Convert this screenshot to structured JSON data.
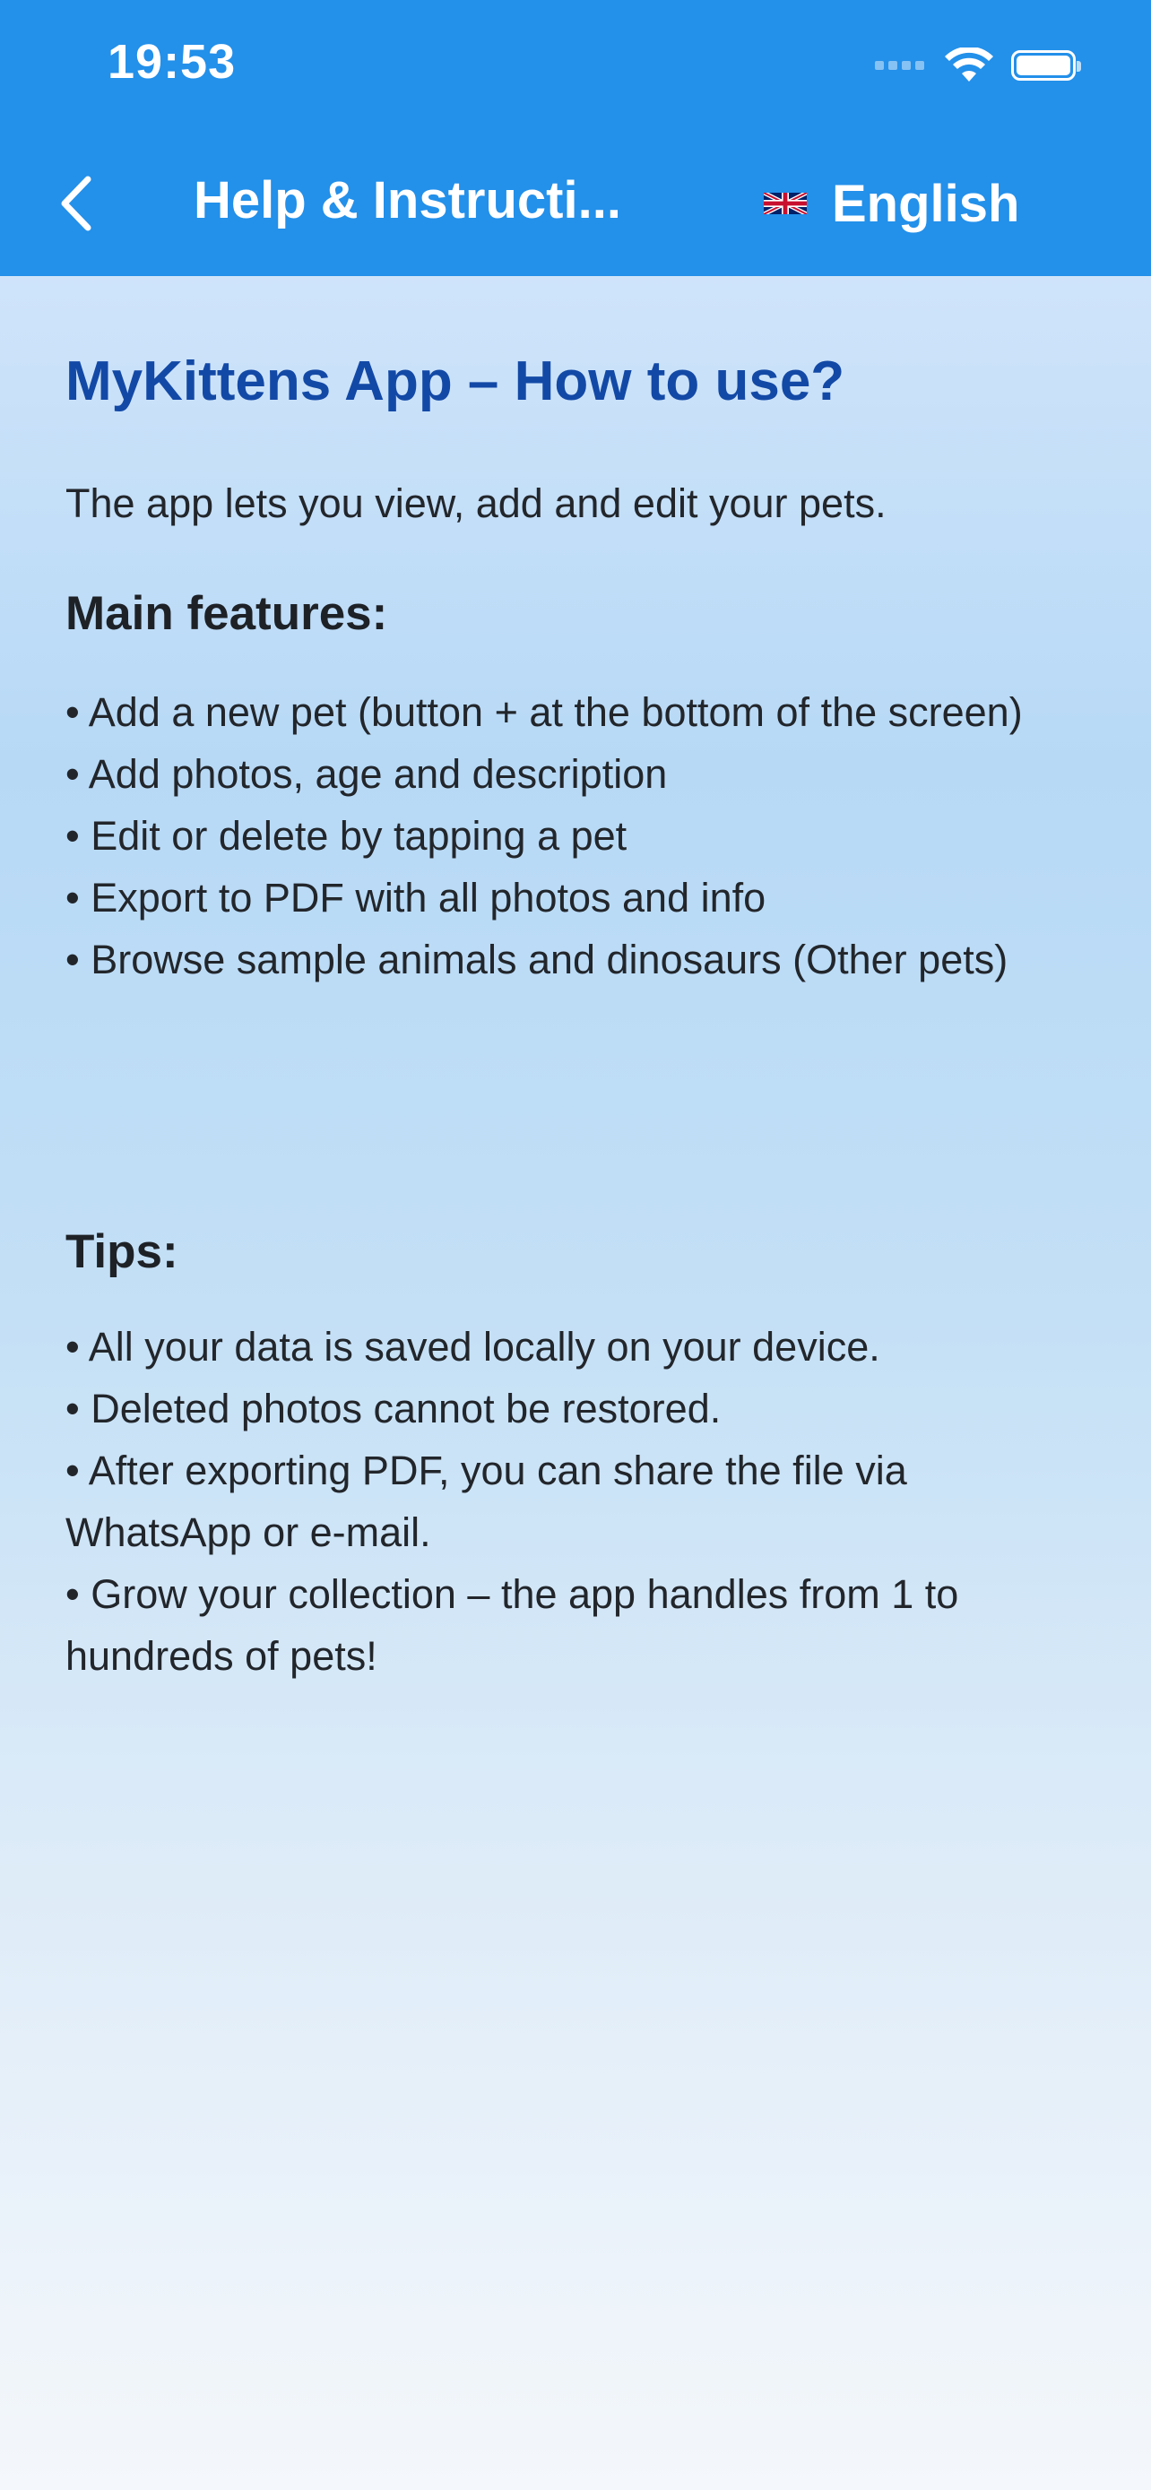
{
  "status_bar": {
    "time": "19:53"
  },
  "nav": {
    "title": "Help & Instructi...",
    "language_label": "English",
    "language_flag": "uk-flag-icon"
  },
  "content": {
    "title": "MyKittens App – How to use?",
    "intro": "The app lets you view, add and edit your pets.",
    "features_heading": "Main features:",
    "features": [
      "• Add a new pet (button + at the bottom of the screen)",
      "• Add photos, age and description",
      "• Edit or delete by tapping a pet",
      "• Export to PDF with all photos and info",
      "• Browse sample animals and dinosaurs (Other pets)"
    ],
    "tips_heading": "Tips:",
    "tips": [
      "• All your data is saved locally on your device.",
      "• Deleted photos cannot be restored.",
      "• After exporting PDF, you can share the file via WhatsApp or e-mail.",
      "• Grow your collection – the app handles from 1 to hundreds of pets!"
    ]
  },
  "colors": {
    "accent": "#2390ea",
    "title_blue": "#1349a6"
  }
}
